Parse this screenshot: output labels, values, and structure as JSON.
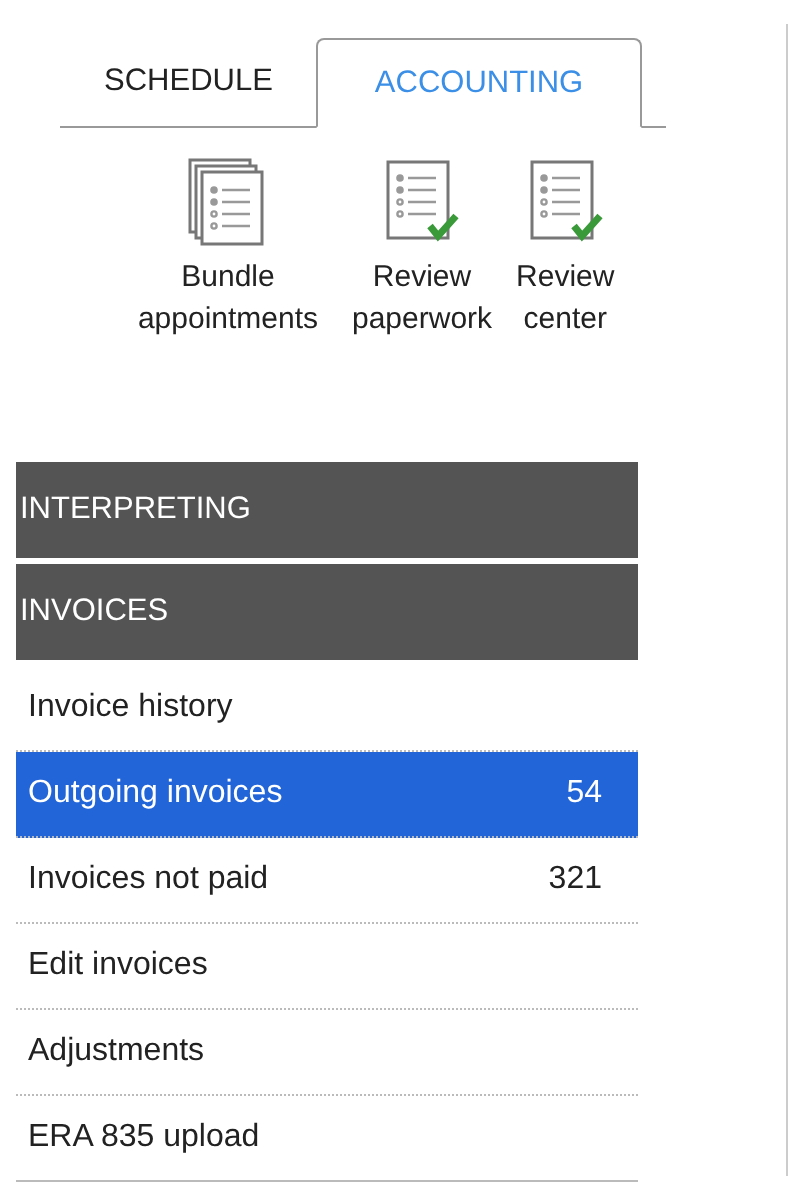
{
  "tabs": [
    {
      "label": "SCHEDULE",
      "selected": false
    },
    {
      "label": "ACCOUNTING",
      "selected": true
    }
  ],
  "toolbar": [
    {
      "kind": "stack",
      "label": "Bundle appointments"
    },
    {
      "kind": "checked",
      "label": "Review paperwork"
    },
    {
      "kind": "checked",
      "label": "Review center"
    }
  ],
  "sections": [
    {
      "title": "INTERPRETING"
    },
    {
      "title": "INVOICES",
      "items": [
        {
          "label": "Invoice history",
          "selected": false
        },
        {
          "label": "Outgoing invoices",
          "count": "54",
          "selected": true
        },
        {
          "label": "Invoices not paid",
          "count": "321",
          "selected": false
        },
        {
          "label": "Edit invoices",
          "selected": false
        },
        {
          "label": "Adjustments",
          "selected": false
        },
        {
          "label": "ERA 835 upload",
          "selected": false
        }
      ]
    }
  ]
}
